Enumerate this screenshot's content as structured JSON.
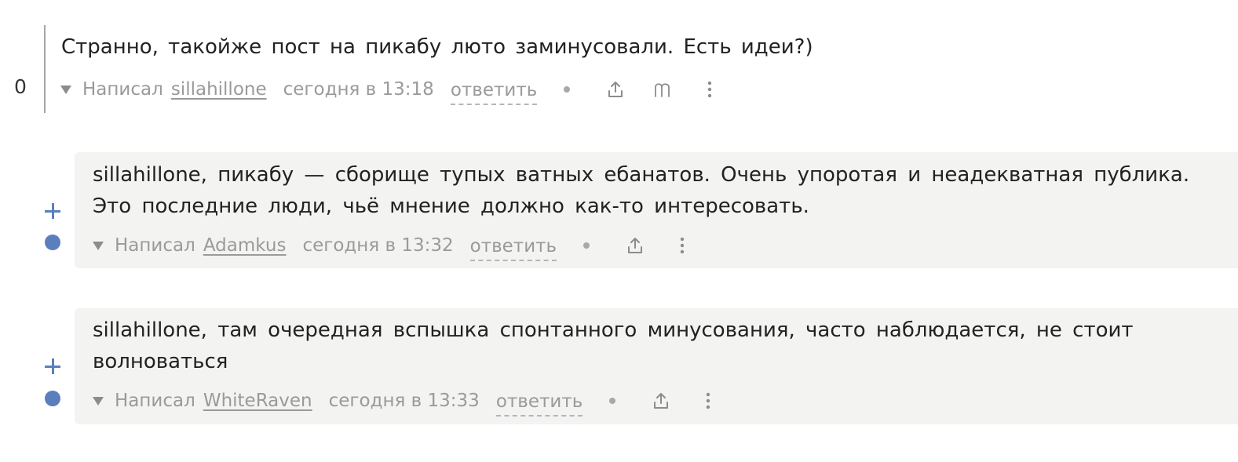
{
  "root_comment": {
    "rating": "0",
    "text": "Странно, такойже пост на пикабу люто заминусовали. Есть идеи?)",
    "written_label": "Написал",
    "author": "sillahillone",
    "time": "сегодня в 13:18",
    "reply_label": "ответить",
    "icons": [
      "collapse-triangle-icon",
      "share-icon",
      "m-icon",
      "more-vertical-icon"
    ]
  },
  "replies": [
    {
      "text": "sillahillone, пикабу — сборище тупых ватных ебанатов. Очень упоротая и неадекватная публика. Это последние люди, чьё мнение должно как-то интересовать.",
      "written_label": "Написал",
      "author": "Adamkus",
      "time": "сегодня в 13:32",
      "reply_label": "ответить",
      "icons": [
        "plus-icon",
        "new-dot-icon",
        "collapse-triangle-icon",
        "share-icon",
        "more-vertical-icon"
      ]
    },
    {
      "text": "sillahillone, там очередная вспышка спонтанного минусования, часто наблюдается, не стоит волноваться",
      "written_label": "Написал",
      "author": "WhiteRaven",
      "time": "сегодня в 13:33",
      "reply_label": "ответить",
      "icons": [
        "plus-icon",
        "new-dot-icon",
        "collapse-triangle-icon",
        "share-icon",
        "more-vertical-icon"
      ]
    }
  ],
  "colors": {
    "accent": "#5b7fbd",
    "meta_text": "#9a9a9a",
    "bubble_bg": "#f3f3f2",
    "thread_line": "#a6a6a6"
  }
}
